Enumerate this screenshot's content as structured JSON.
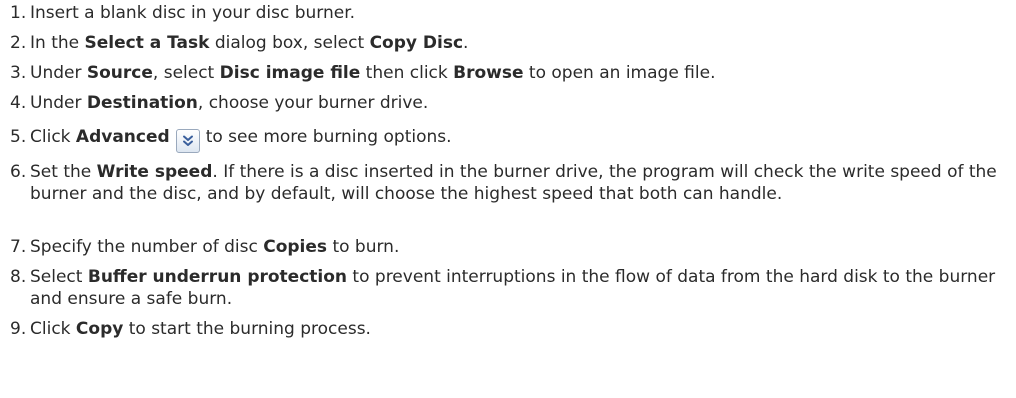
{
  "steps": [
    {
      "number": "1.",
      "text": [
        "Insert a blank disc in your disc burner."
      ]
    },
    {
      "number": "2.",
      "text": [
        "In the ",
        "Select a Task",
        " dialog box, select ",
        "Copy Disc",
        "."
      ]
    },
    {
      "number": "3.",
      "text": [
        "Under ",
        "Source",
        ", select ",
        "Disc image file",
        " then click ",
        "Browse",
        " to open an image file."
      ]
    },
    {
      "number": "4.",
      "text": [
        "Under ",
        "Destination",
        ", choose your burner drive."
      ]
    },
    {
      "number": "5.",
      "text": [
        "Click ",
        "Advanced",
        "to see more burning options."
      ],
      "icon": "double-chevron-down-icon"
    },
    {
      "number": "6.",
      "text": [
        "Set the ",
        "Write speed",
        ". If there is a disc inserted in the burner drive, the program will check the write speed of the burner and the disc, and by default, will choose the highest speed that both can handle."
      ]
    },
    {
      "number": "7.",
      "text": [
        "Specify the number of disc ",
        "Copies",
        " to burn."
      ]
    },
    {
      "number": "8.",
      "text": [
        "Select ",
        "Buffer underrun protection",
        " to prevent interruptions in the flow of data from the hard disk to the burner and ensure a safe burn."
      ]
    },
    {
      "number": "9.",
      "text": [
        "Click ",
        "Copy",
        " to start the burning process."
      ]
    }
  ]
}
